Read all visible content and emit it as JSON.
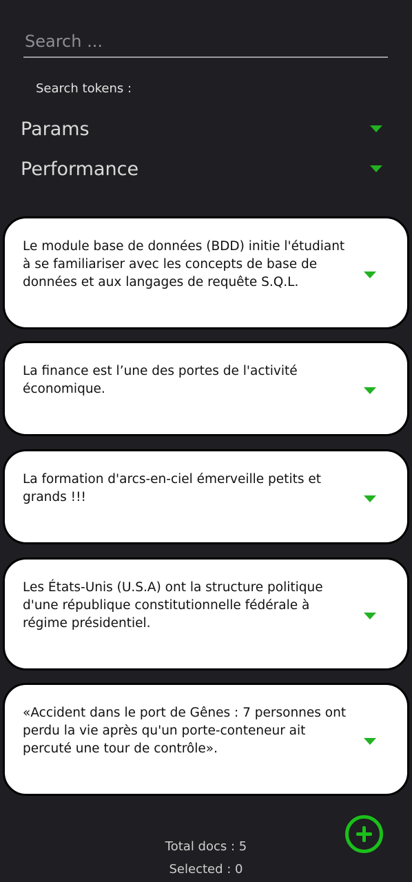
{
  "search": {
    "placeholder": "Search ..."
  },
  "tokens_label": "Search tokens :",
  "accordions": [
    {
      "title": "Params",
      "icon": "chevron-down-icon"
    },
    {
      "title": "Performance",
      "icon": "chevron-down-icon"
    }
  ],
  "documents": [
    {
      "text": "Le module base de données (BDD) initie l'étudiant à se familiariser avec les concepts de base de données et aux langages de requête S.Q.L."
    },
    {
      "text": "La finance est l’une des portes de l'activité économique."
    },
    {
      "text": "La formation d'arcs-en-ciel émerveille petits et grands !!!"
    },
    {
      "text": "Les États-Unis (U.S.A)  ont la structure politique d'une république constitutionnelle fédérale à régime présidentiel."
    },
    {
      "text": "«Accident dans le port de Gênes : 7 personnes ont perdu la vie après qu'un porte-conteneur ait percuté une tour de contrôle»."
    }
  ],
  "footer": {
    "total_docs": "Total docs : 5",
    "selected": "Selected : 0"
  },
  "colors": {
    "background": "#1f1e22",
    "accent": "#1bbf1b",
    "card": "#ffffff"
  }
}
